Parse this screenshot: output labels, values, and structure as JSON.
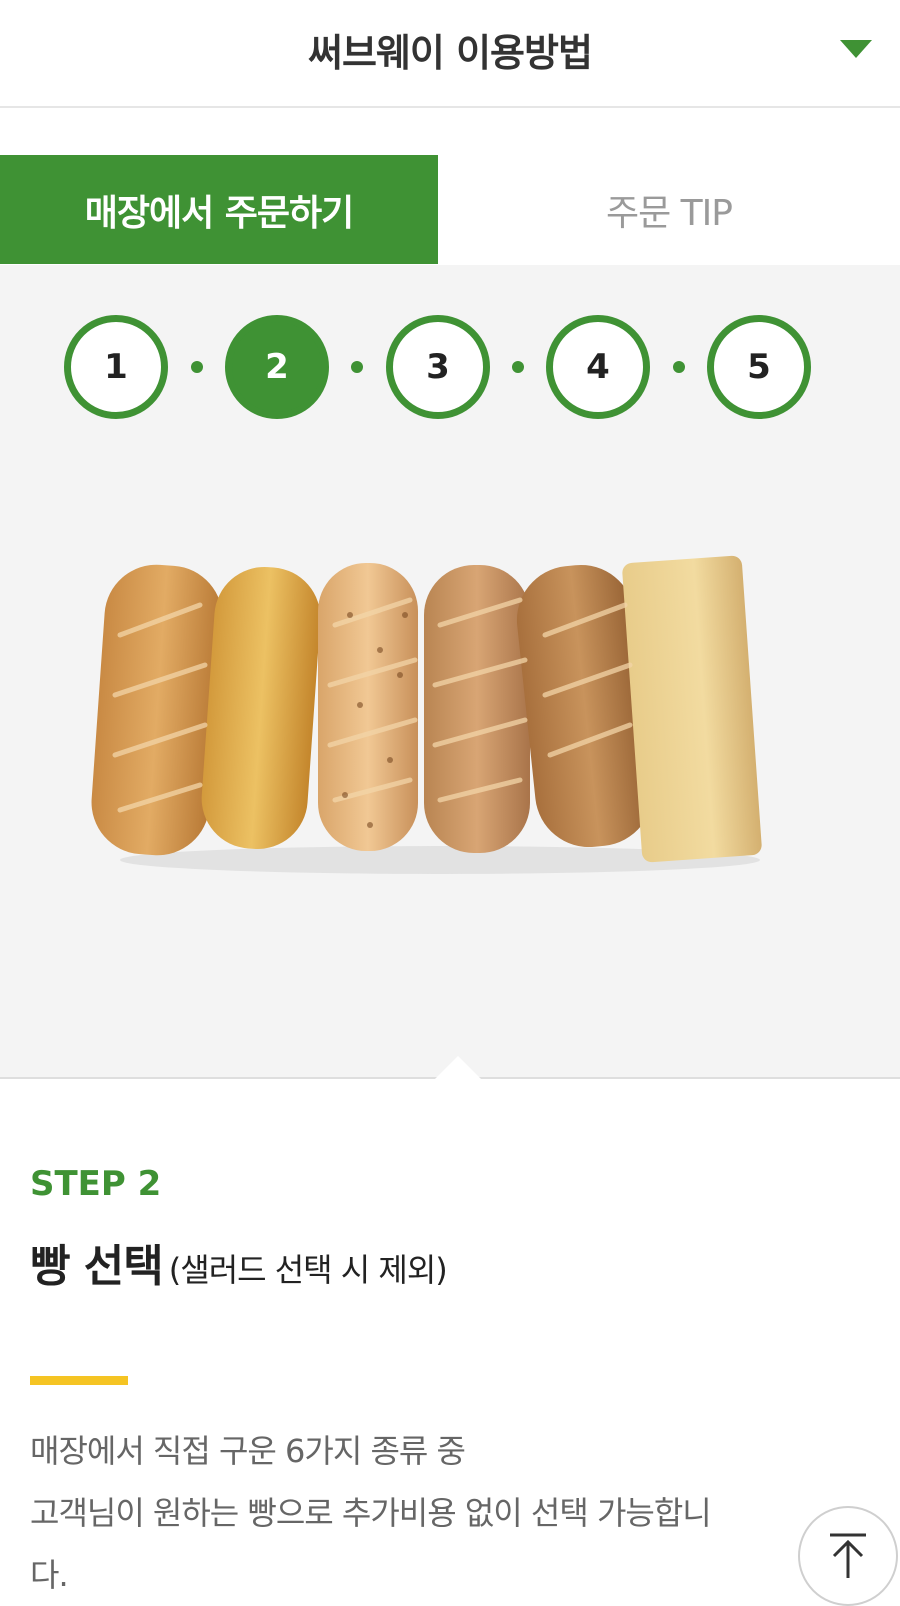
{
  "header": {
    "title": "써브웨이 이용방법",
    "dropdown_icon": "caret-down-icon"
  },
  "tabs": [
    {
      "label": "매장에서 주문하기",
      "active": true
    },
    {
      "label": "주문 TIP",
      "active": false
    }
  ],
  "steps": [
    {
      "number": "1",
      "active": false
    },
    {
      "number": "2",
      "active": true
    },
    {
      "number": "3",
      "active": false
    },
    {
      "number": "4",
      "active": false
    },
    {
      "number": "5",
      "active": false
    }
  ],
  "gallery": {
    "image_description": "bread-varieties-image"
  },
  "content": {
    "step_label": "STEP 2",
    "heading_main": "빵 선택",
    "heading_sub": "(샐러드 선택 시 제외)",
    "description_line1": "매장에서 직접 구운 6가지 종류 중",
    "description_line2": "고객님이 원하는 빵으로 추가비용 없이 선택 가능합니",
    "description_line3": "다."
  },
  "scroll_top_icon": "arrow-up-icon",
  "colors": {
    "accent": "#3f9234",
    "highlight": "#f5c423",
    "text_dark": "#222222",
    "text_muted": "#666666"
  }
}
